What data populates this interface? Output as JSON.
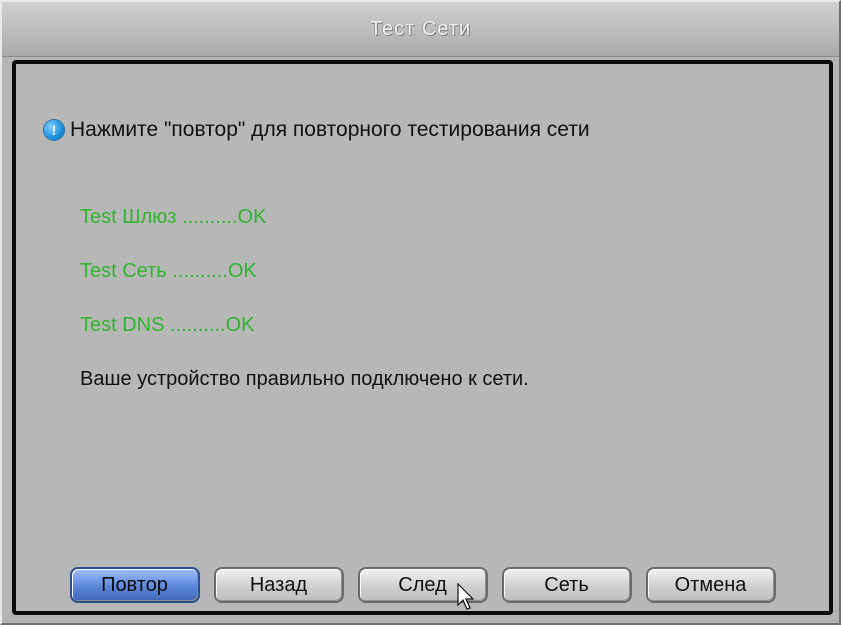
{
  "window": {
    "title": "Тест Сети"
  },
  "hint": {
    "icon": "info-icon",
    "text": "Нажмите \"повтор\" для повторного тестирования сети"
  },
  "results": [
    {
      "text": "Test Шлюз ..........OK"
    },
    {
      "text": "Test Сеть ..........OK"
    },
    {
      "text": "Test DNS ..........OK"
    }
  ],
  "summary": "Ваше устройство правильно подключено к сети.",
  "buttons": {
    "retry": "Повтор",
    "back": "Назад",
    "next": "След",
    "network": "Сеть",
    "cancel": "Отмена"
  },
  "colors": {
    "ok_text": "#2db52d",
    "active_button": "#5b86d8"
  }
}
